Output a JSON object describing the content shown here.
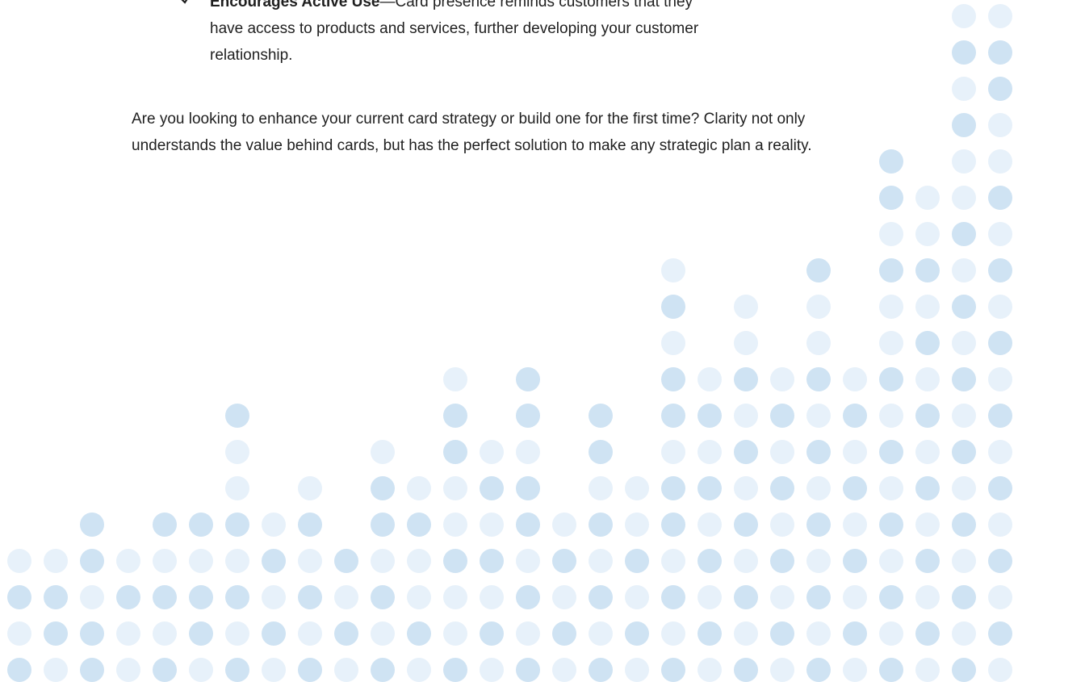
{
  "bullet": {
    "icon": "checkmark-icon",
    "heading": "Encourages Active Use",
    "dash": "—",
    "text": "Card presence reminds customers that they have access to products and services, further developing your customer relationship."
  },
  "paragraph": {
    "text": "Are you looking to enhance your current card strategy or build one for the first time?  Clarity not only understands the value behind cards, but has the perfect solution to make any strategic plan a reality."
  },
  "decoration": {
    "name": "dot-pattern",
    "colors": {
      "dark": "#cfe3f3",
      "light": "#e7f1fa"
    },
    "columns": [
      [
        "DLDL"
      ],
      [
        "LDDL"
      ],
      [
        "DDLDD"
      ],
      [
        "LLDL"
      ],
      [
        "DLDLD"
      ],
      [
        "LDDLD"
      ],
      [
        "DLDLDLLD"
      ],
      [
        "LDLDL"
      ],
      [
        "DLDLDL"
      ],
      [
        "LDLD"
      ],
      [
        "DLDLDDL"
      ],
      [
        "LDLLDL"
      ],
      [
        "DLLDLLDDL"
      ],
      [
        "LDLDLDL"
      ],
      [
        "DLDLDDLDD"
      ],
      [
        "LDLDL"
      ],
      [
        "DLDLDLDD"
      ],
      [
        "LDLDLL"
      ],
      [
        "DLDLDDLDDLDL"
      ],
      [
        "LDLDLDLDL"
      ],
      [
        "DLDLDLDLDLL"
      ],
      [
        "LDLDLDLDL"
      ],
      [
        "DLDLDLDLDLLD"
      ],
      [
        "LDLDLDLDL"
      ],
      [
        "DLDLDLDLDLLDLDD"
      ],
      [
        "LDLDLDLDLDLDLL"
      ],
      [
        "DLDLDLDLDLDLDLLDLDLLD"
      ],
      [
        "LDLDLDLDLDLDLDLLDDLDLD"
      ]
    ]
  }
}
